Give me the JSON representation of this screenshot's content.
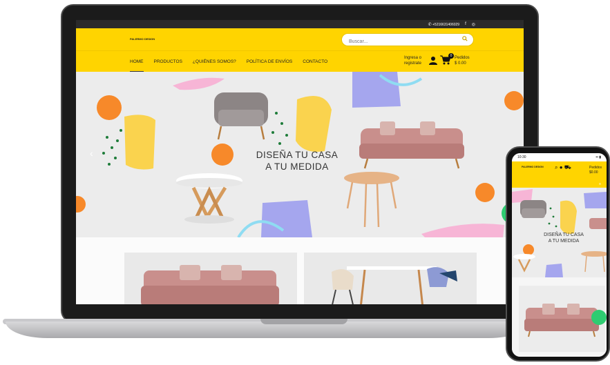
{
  "topbar": {
    "phone": "+5216631406029",
    "facebook_icon": "f",
    "instagram_icon": "◎"
  },
  "header": {
    "brand": "PALERMO DESIGN",
    "search_placeholder": "Buscar..."
  },
  "nav": {
    "items": [
      {
        "label": "HOME",
        "active": true
      },
      {
        "label": "PRODUCTOS"
      },
      {
        "label": "¿QUIÉNES SOMOS?"
      },
      {
        "label": "POLÍTICA DE ENVÍOS"
      },
      {
        "label": "CONTACTO"
      }
    ]
  },
  "account": {
    "line1": "Ingresa o",
    "line2": "registrate"
  },
  "cart": {
    "count": "0",
    "label": "Pedidos",
    "total": "$ 0.00"
  },
  "hero": {
    "line1": "DISEÑA TU CASA",
    "line2": "A TU MEDIDA"
  },
  "phone": {
    "time": "10:30",
    "brand": "PALERMO DESIGN",
    "cart_label": "Pedidos",
    "cart_total": "$0.00",
    "hero_line1": "DISEÑA TU CASA",
    "hero_line2": "A TU MEDIDA"
  },
  "colors": {
    "brand_yellow": "#ffd400",
    "whatsapp_green": "#2ecc71",
    "sofa_pink": "#c98f8c"
  }
}
